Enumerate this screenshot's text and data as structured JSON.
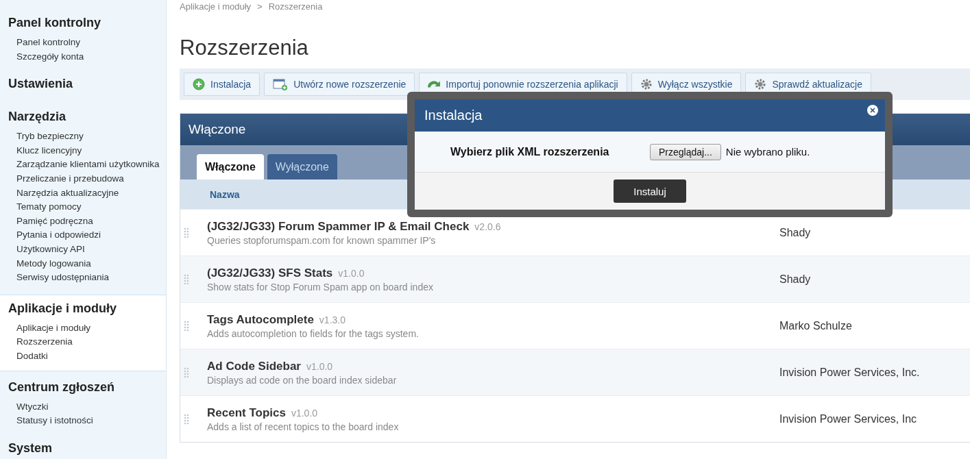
{
  "sidebar": {
    "sections": [
      {
        "title": "Panel kontrolny",
        "selected": false,
        "items": [
          "Panel kontrolny",
          "Szczegóły konta"
        ]
      },
      {
        "title": "Ustawienia",
        "selected": false
      },
      {
        "title": "Narzędzia",
        "selected": false,
        "items": [
          "Tryb bezpieczny",
          "Klucz licencyjny",
          "Zarządzanie klientami użytkownika",
          "Przeliczanie i przebudowa",
          "Narzędzia aktualizacyjne",
          "Tematy pomocy",
          "Pamięć podręczna",
          "Pytania i odpowiedzi",
          "Użytkownicy API",
          "Metody logowania",
          "Serwisy udostępniania"
        ]
      },
      {
        "title": "Aplikacje i moduły",
        "selected": true,
        "items": [
          "Aplikacje i moduły",
          "Rozszerzenia",
          "Dodatki"
        ]
      },
      {
        "title": "Centrum zgłoszeń",
        "selected": false,
        "items": [
          "Wtyczki",
          "Statusy i istotności"
        ]
      },
      {
        "title": "System",
        "selected": false
      }
    ]
  },
  "breadcrumb": {
    "items": [
      "Aplikacje i moduły",
      "Rozszerzenia"
    ],
    "separator": ">"
  },
  "page_title": "Rozszerzenia",
  "toolbar": [
    {
      "label": "Instalacja",
      "kind": "add"
    },
    {
      "label": "Utwórz nowe rozszerzenie",
      "kind": "create"
    },
    {
      "label": "Importuj ponownie rozszerzenia aplikacji",
      "kind": "import"
    },
    {
      "label": "Wyłącz wszystkie",
      "kind": "gear"
    },
    {
      "label": "Sprawdź aktualizacje",
      "kind": "gear"
    }
  ],
  "panel": {
    "title": "Włączone",
    "tabs": [
      {
        "label": "Włączone",
        "selected": true
      },
      {
        "label": "Wyłączone",
        "selected": false
      }
    ],
    "column": "Nazwa",
    "rows": [
      {
        "name": "(JG32/JG33) Forum Spammer IP & Email Check",
        "version": "v2.0.6",
        "description": "Queries stopforumspam.com for known spammer IP's",
        "author": "Shady"
      },
      {
        "name": "(JG32/JG33) SFS Stats",
        "version": "v1.0.0",
        "description": "Show stats for Stop Forum Spam app on board index",
        "author": "Shady"
      },
      {
        "name": "Tags Autocomplete",
        "version": "v1.3.0",
        "description": "Adds autocompletion to fields for the tags system.",
        "author": "Marko Schulze"
      },
      {
        "name": "Ad Code Sidebar",
        "version": "v1.0.0",
        "description": "Displays ad code on the board index sidebar",
        "author": "Invision Power Services, Inc."
      },
      {
        "name": "Recent Topics",
        "version": "v1.0.0",
        "description": "Adds a list of recent topics to the board index",
        "author": "Invision Power Services, Inc"
      }
    ]
  },
  "modal": {
    "title": "Instalacja",
    "field_label": "Wybierz plik XML rozszerzenia",
    "browse_button": "Przeglądaj...",
    "file_status": "Nie wybrano pliku.",
    "submit": "Instaluj"
  }
}
